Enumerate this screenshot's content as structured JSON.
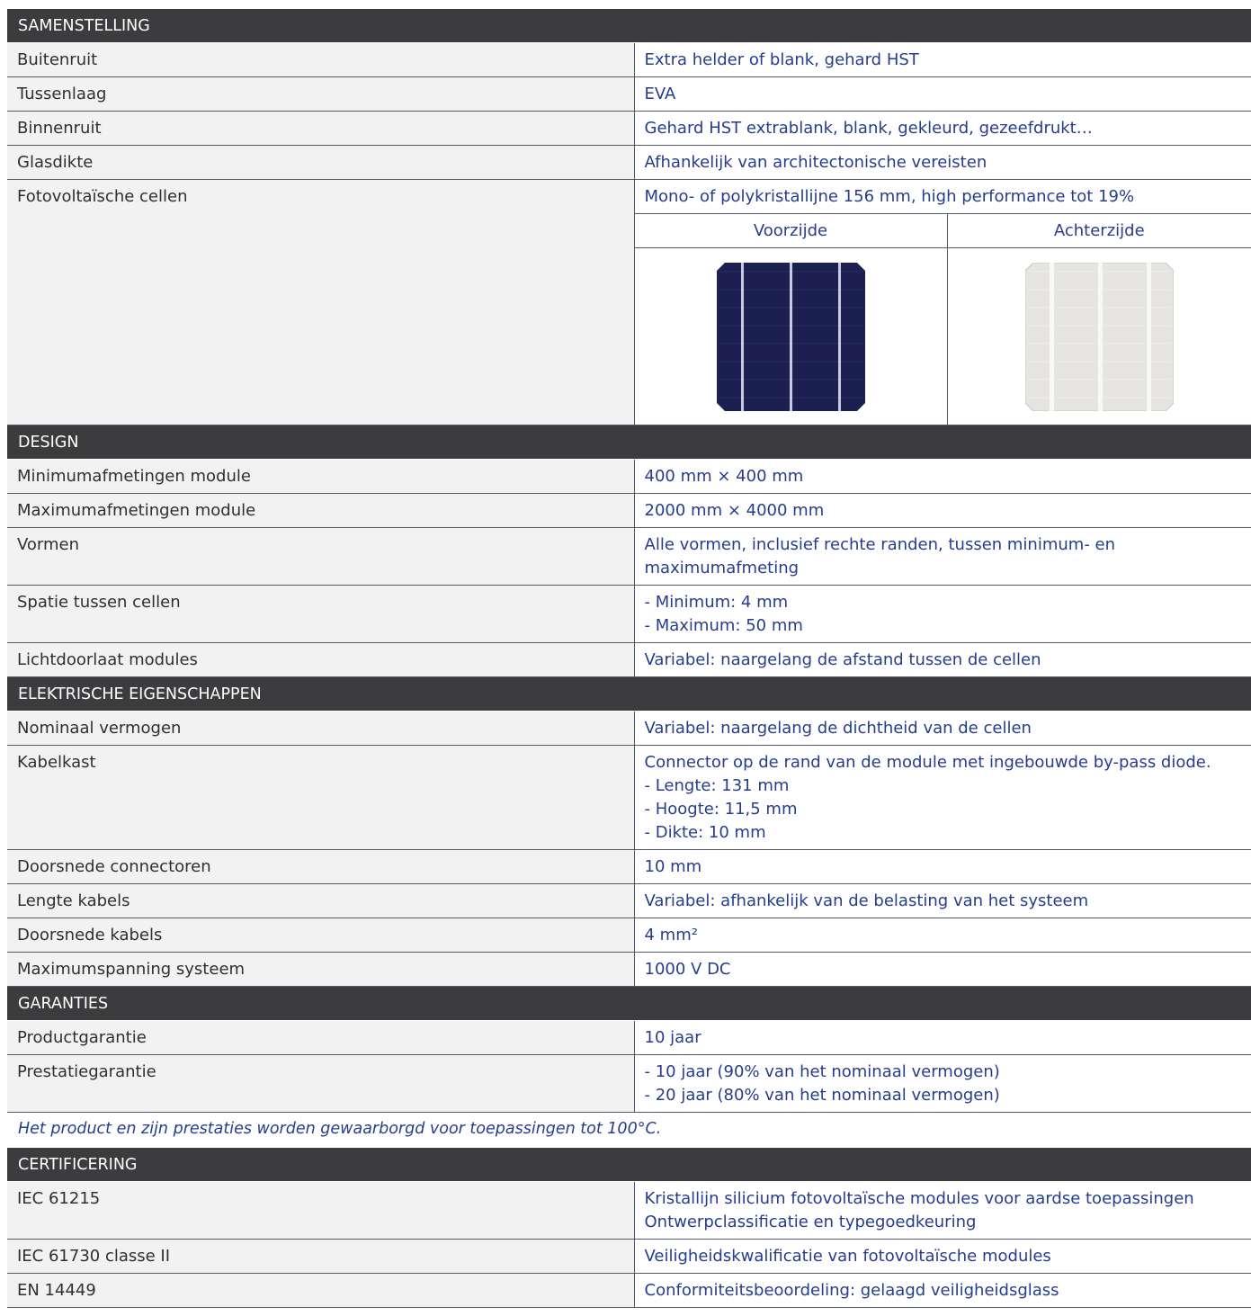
{
  "sections": [
    {
      "title": "SAMENSTELLING",
      "rows": [
        {
          "label": "Buitenruit",
          "value": [
            "Extra helder of blank, gehard HST"
          ]
        },
        {
          "label": "Tussenlaag",
          "value": [
            "EVA"
          ]
        },
        {
          "label": "Binnenruit",
          "value": [
            "Gehard HST extrablank, blank, gekleurd, gezeefdrukt…"
          ]
        },
        {
          "label": "Glasdikte",
          "value": [
            "Afhankelijk van architectonische vereisten"
          ]
        },
        {
          "label": "Fotovoltaïsche cellen",
          "value": [
            "Mono- of polykristallijne 156 mm, high performance tot 19%"
          ]
        }
      ],
      "cells": {
        "front_label": "Voorzijde",
        "back_label": "Achterzijde",
        "front_color": "#1c2050",
        "back_color": "#e6e4e0"
      }
    },
    {
      "title": "DESIGN",
      "rows": [
        {
          "label": "Minimumafmetingen module",
          "value": [
            "400 mm × 400 mm"
          ]
        },
        {
          "label": "Maximumafmetingen module",
          "value": [
            "2000 mm × 4000 mm"
          ]
        },
        {
          "label": "Vormen",
          "value": [
            "Alle vormen, inclusief rechte randen, tussen minimum- en",
            "maximumafmeting"
          ]
        },
        {
          "label": "Spatie tussen cellen",
          "value": [
            "- Minimum: 4 mm",
            "- Maximum: 50 mm"
          ]
        },
        {
          "label": "Lichtdoorlaat modules",
          "value": [
            "Variabel: naargelang de afstand tussen de cellen"
          ]
        }
      ]
    },
    {
      "title": "ELEKTRISCHE EIGENSCHAPPEN",
      "rows": [
        {
          "label": "Nominaal vermogen",
          "value": [
            "Variabel: naargelang de dichtheid van de cellen"
          ]
        },
        {
          "label": "Kabelkast",
          "value": [
            "Connector op de rand van de module met ingebouwde by-pass diode.",
            "- Lengte: 131 mm",
            "- Hoogte: 11,5 mm",
            "- Dikte: 10 mm"
          ]
        },
        {
          "label": "Doorsnede connectoren",
          "value": [
            "10 mm"
          ]
        },
        {
          "label": "Lengte kabels",
          "value": [
            "Variabel: afhankelijk van de belasting van het systeem"
          ]
        },
        {
          "label": "Doorsnede kabels",
          "value": [
            "4 mm²"
          ]
        },
        {
          "label": "Maximumspanning systeem",
          "value": [
            "1000 V DC"
          ]
        }
      ]
    },
    {
      "title": "GARANTIES",
      "rows": [
        {
          "label": "Productgarantie",
          "value": [
            "10 jaar"
          ]
        },
        {
          "label": "Prestatiegarantie",
          "value": [
            "- 10 jaar (90% van het nominaal vermogen)",
            "- 20 jaar (80% van het nominaal vermogen)"
          ]
        }
      ],
      "note": "Het product en zijn prestaties worden gewaarborgd voor toepassingen tot 100°C."
    },
    {
      "title": "CERTIFICERING",
      "rows": [
        {
          "label": "IEC 61215",
          "value": [
            "Kristallijn silicium fotovoltaïsche modules voor aardse toepassingen",
            "Ontwerpclassificatie en typegoedkeuring"
          ]
        },
        {
          "label": "IEC 61730 classe II",
          "value": [
            "Veiligheidskwalificatie van fotovoltaïsche modules"
          ]
        },
        {
          "label": "EN 14449",
          "value": [
            "Conformiteitsbeoordeling: gelaagd veiligheidsglass"
          ]
        }
      ]
    }
  ]
}
